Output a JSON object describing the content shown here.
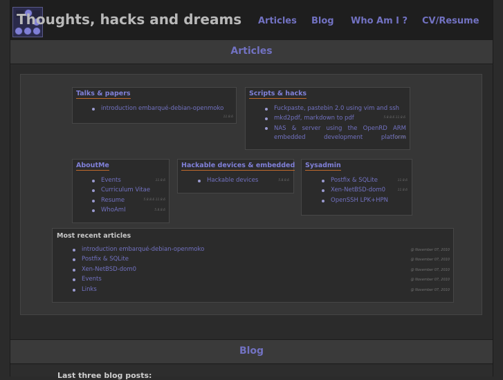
{
  "header": {
    "site_title": "Thoughts, hacks and dreams",
    "logo_icon": "glider-logo-icon",
    "nav": [
      "Articles",
      "Blog",
      "Who Am I ?",
      "CV/Resume"
    ]
  },
  "sections": {
    "articles": "Articles",
    "blog": "Blog",
    "blog_subheading": "Last three blog posts:"
  },
  "categories": {
    "talks": {
      "title": "Talks & papers",
      "items": [
        {
          "label": "introduction embarqué-debian-openmoko",
          "meta": "11.8.6"
        }
      ]
    },
    "scripts": {
      "title": "Scripts & hacks",
      "items": [
        {
          "label": "Fuckpaste, pastebin 2.0 using vim and ssh",
          "meta": ""
        },
        {
          "label": "mkd2pdf, markdown to pdf",
          "meta": "5.8.8.6   11.8.6"
        },
        {
          "label": "NAS & server using the OpenRD ARM embedded development platform",
          "meta": "5.8.8.6"
        }
      ]
    },
    "about": {
      "title": "AboutMe",
      "items": [
        {
          "label": "Events",
          "meta": "11.8.6"
        },
        {
          "label": "Curriculum Vitae",
          "meta": ""
        },
        {
          "label": "Resume",
          "meta": "5.8.8.6   11.8.6"
        },
        {
          "label": "WhoAmI",
          "meta": "5.8.8.6"
        }
      ]
    },
    "hackable": {
      "title": "Hackable devices & embedded",
      "items": [
        {
          "label": "Hackable devices",
          "meta": "5.8.8.6"
        }
      ]
    },
    "sysadmin": {
      "title": "Sysadmin",
      "items": [
        {
          "label": "Postfix & SQLite",
          "meta": "11.8.6"
        },
        {
          "label": "Xen-NetBSD-dom0",
          "meta": "11.8.6"
        },
        {
          "label": "OpenSSH LPK+HPN",
          "meta": ""
        }
      ]
    }
  },
  "recent": {
    "title": "Most recent articles",
    "items": [
      {
        "label": "introduction embarqué-debian-openmoko",
        "date": "@ November 07, 2010"
      },
      {
        "label": "Postfix & SQLite",
        "date": "@ November 07, 2010"
      },
      {
        "label": "Xen-NetBSD-dom0",
        "date": "@ November 07, 2010"
      },
      {
        "label": "Events",
        "date": "@ November 07, 2010"
      },
      {
        "label": "Links",
        "date": "@ November 07, 2010"
      }
    ]
  },
  "colors": {
    "accent_link": "#7272c2",
    "underline": "#c06a2c",
    "background": "#2b2b2b"
  }
}
